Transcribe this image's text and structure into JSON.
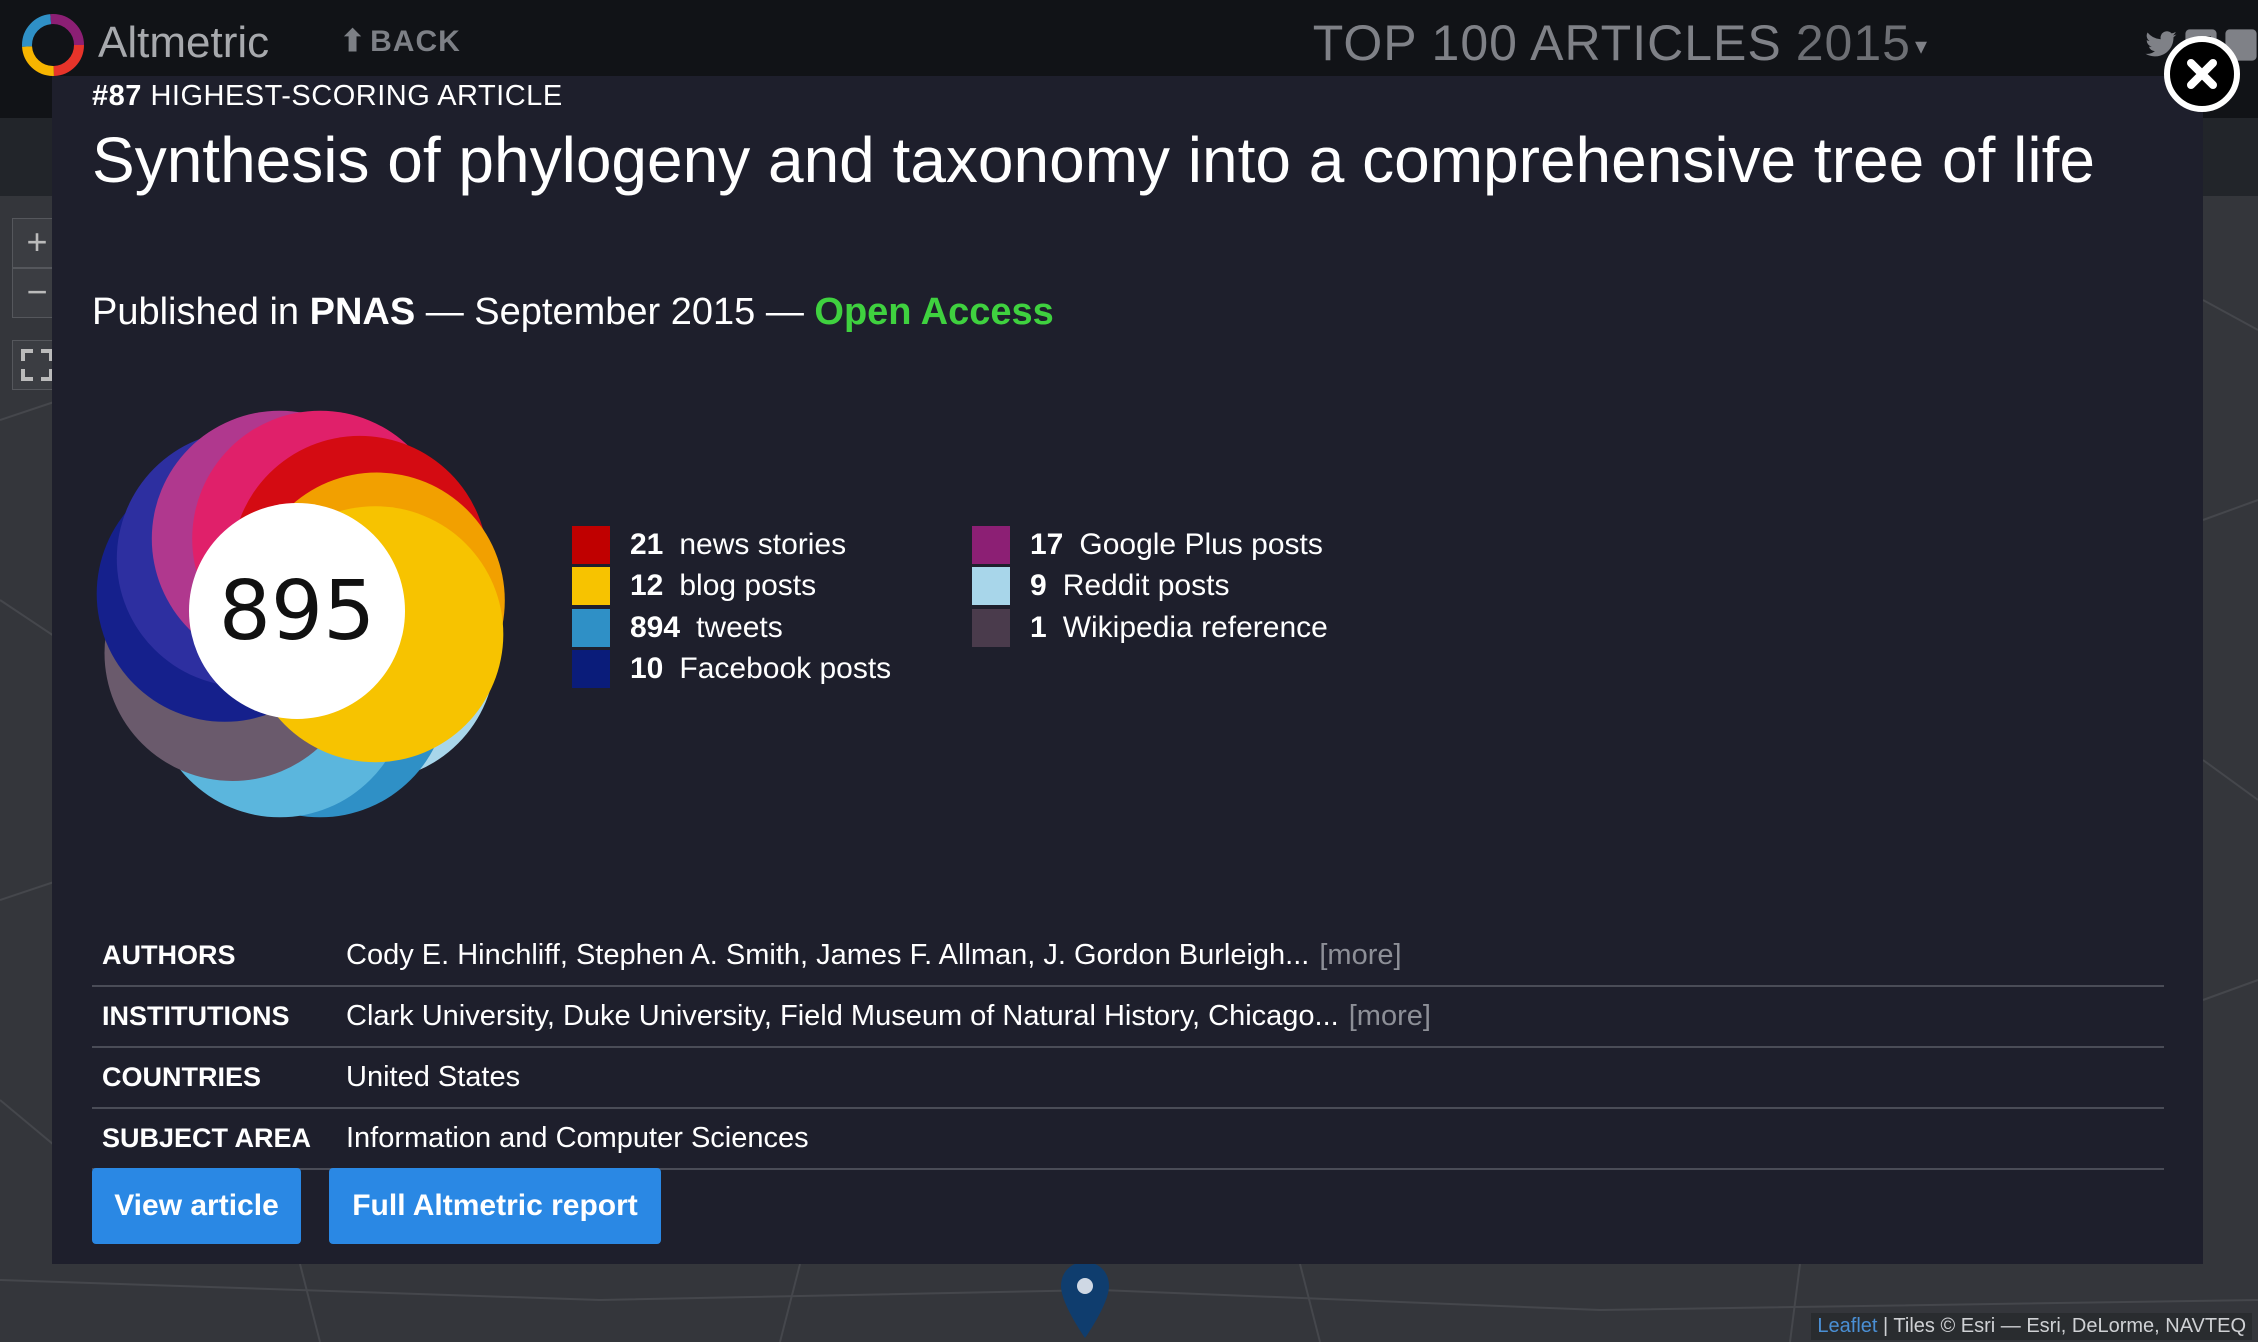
{
  "header": {
    "logo_text": "Altmetric",
    "back_label": "BACK",
    "section_title": "TOP 100 ARTICLES",
    "year": "2015",
    "icons": [
      "twitter-icon",
      "facebook-icon",
      "share-icon"
    ]
  },
  "map": {
    "zoom_in": "+",
    "zoom_out": "−",
    "attribution_link": "Leaflet",
    "attribution_text": " | Tiles © Esri — Esri, DeLorme, NAVTEQ"
  },
  "article": {
    "rank": "#87",
    "rank_label": "HIGHEST-SCORING ARTICLE",
    "title": "Synthesis of phylogeny and taxonomy into a comprehensive tree of life",
    "published_prefix": "Published in ",
    "journal": "PNAS",
    "sep1": " — ",
    "date": "September 2015",
    "sep2": " — ",
    "access": "Open Access",
    "score": "895"
  },
  "colors": {
    "news": "#c00000",
    "blogs": "#f7c300",
    "tweets": "#2f90c6",
    "facebook": "#0a1c7a",
    "google_plus": "#8c1f74",
    "reddit": "#a8d6ea",
    "wikipedia": "#4a3b4c",
    "open_access": "#3fd13f",
    "button": "#2a88e4"
  },
  "legend_left": [
    {
      "count": "21",
      "label": "news stories",
      "color": "#c00000"
    },
    {
      "count": "12",
      "label": "blog posts",
      "color": "#f7c300"
    },
    {
      "count": "894",
      "label": "tweets",
      "color": "#2f90c6"
    },
    {
      "count": "10",
      "label": "Facebook posts",
      "color": "#0a1c7a"
    }
  ],
  "legend_right": [
    {
      "count": "17",
      "label": "Google Plus posts",
      "color": "#8c1f74"
    },
    {
      "count": "9",
      "label": "Reddit posts",
      "color": "#a8d6ea"
    },
    {
      "count": "1",
      "label": "Wikipedia reference",
      "color": "#4a3b4c"
    }
  ],
  "info": [
    {
      "label": "AUTHORS",
      "value": "Cody E. Hinchliff, Stephen A. Smith, James F. Allman, J. Gordon Burleigh...",
      "more": "[more]"
    },
    {
      "label": "INSTITUTIONS",
      "value": "Clark University, Duke University, Field Museum of Natural History, Chicago...",
      "more": "[more]"
    },
    {
      "label": "COUNTRIES",
      "value": "United States",
      "more": ""
    },
    {
      "label": "SUBJECT AREA",
      "value": "Information and Computer Sciences",
      "more": ""
    }
  ],
  "buttons": {
    "view_article": "View article",
    "full_report": "Full Altmetric report"
  }
}
